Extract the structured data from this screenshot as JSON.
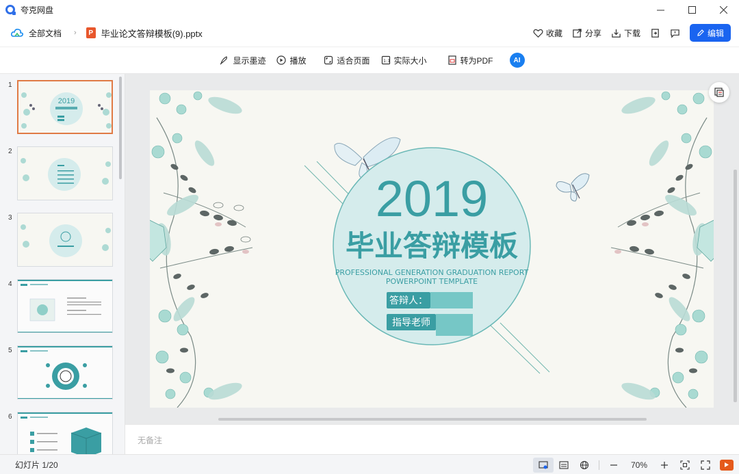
{
  "app": {
    "title": "夸克网盘"
  },
  "window_controls": {
    "minimize": "—",
    "maximize": "☐",
    "close": "✕"
  },
  "docbar": {
    "all_docs": "全部文档",
    "file_name": "毕业论文答辩模板(9).pptx",
    "file_badge": "P",
    "actions": {
      "favorite": "收藏",
      "share": "分享",
      "download": "下载",
      "edit": "编辑"
    }
  },
  "toolbar": {
    "show_ink": "显示墨迹",
    "play": "播放",
    "fit_page": "适合页面",
    "actual_size": "实际大小",
    "to_pdf": "转为PDF",
    "ai": "AI"
  },
  "thumbnails": [
    {
      "num": "1",
      "selected": true
    },
    {
      "num": "2",
      "selected": false
    },
    {
      "num": "3",
      "selected": false
    },
    {
      "num": "4",
      "selected": false
    },
    {
      "num": "5",
      "selected": false
    },
    {
      "num": "6",
      "selected": false
    }
  ],
  "slide": {
    "year": "2019",
    "title": "毕业答辩模板",
    "subtitle_line1": "PROFESSIONAL GENERATION GRADUATION REPORT",
    "subtitle_line2": "POWERPOINT TEMPLATE",
    "label_presenter": "答辩人：",
    "label_advisor": "指导老师",
    "accent_color": "#3a9ea3",
    "circle_fill": "#d5ecec"
  },
  "notes": {
    "placeholder": "无备注"
  },
  "status": {
    "slide_count": "幻灯片 1/20",
    "zoom": "70%",
    "zoom_out": "—",
    "zoom_in": "+"
  }
}
